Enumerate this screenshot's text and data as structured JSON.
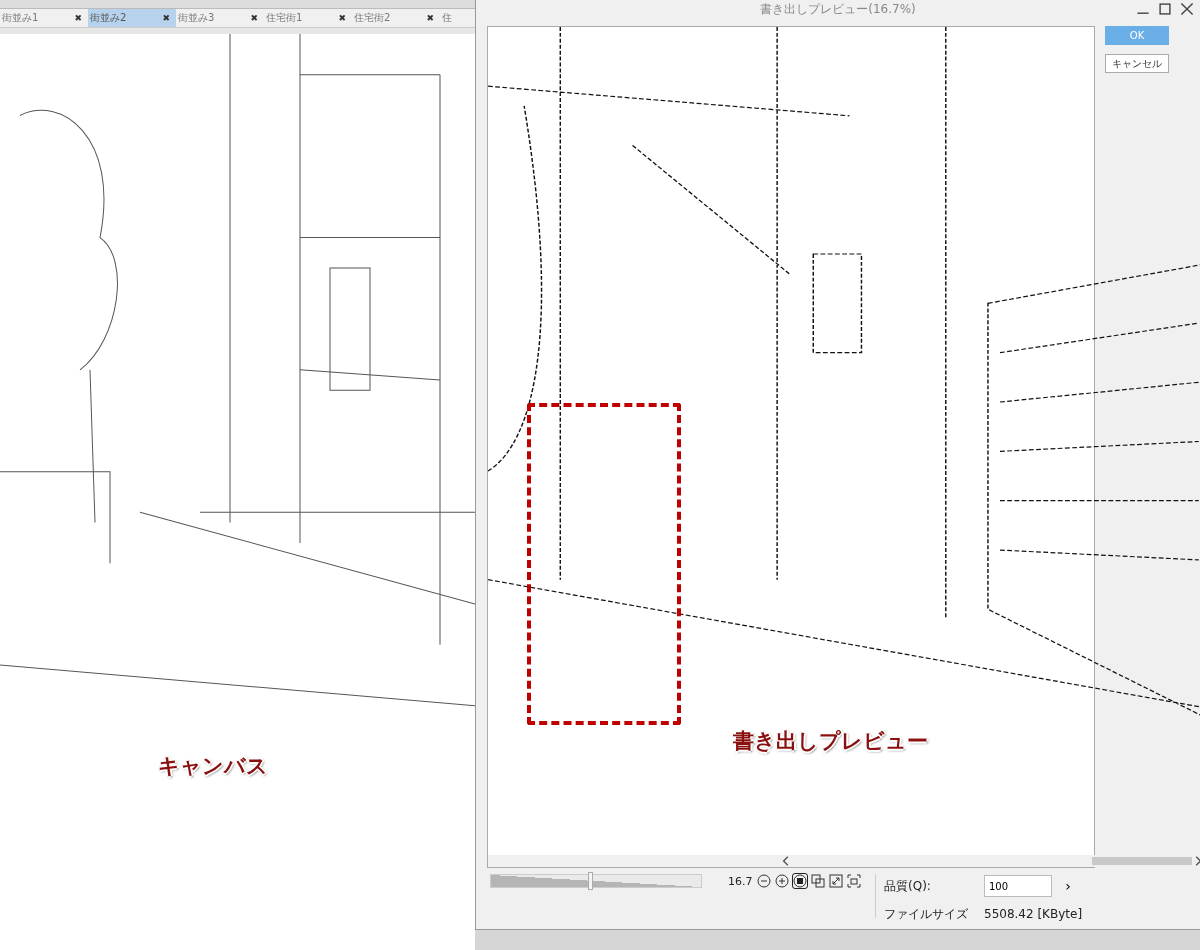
{
  "tabs": [
    {
      "label": "街並み1",
      "selected": false,
      "close": "✖"
    },
    {
      "label": "街並み2",
      "selected": true,
      "close": "✖"
    },
    {
      "label": "街並み3",
      "selected": false,
      "close": "✖"
    },
    {
      "label": "住宅街1",
      "selected": false,
      "close": "✖"
    },
    {
      "label": "住宅街2",
      "selected": false,
      "close": "✖"
    },
    {
      "label": "住",
      "selected": false
    }
  ],
  "canvas": {
    "caption": "キャンバス"
  },
  "dialog": {
    "title": "書き出しプレビュー(16.7%)",
    "preview": {
      "caption": "書き出しプレビュー"
    },
    "zoom": {
      "level": 0.46,
      "value": "16.7"
    },
    "quality": {
      "label": "品質(Q):",
      "value": "100",
      "more": "›"
    },
    "file_size": {
      "label": "ファイルサイズ",
      "value": "5508.42 [KByte]"
    },
    "buttons": [
      {
        "label": "OK",
        "primary": true
      },
      {
        "label": "キャンセル",
        "primary": false
      }
    ]
  }
}
